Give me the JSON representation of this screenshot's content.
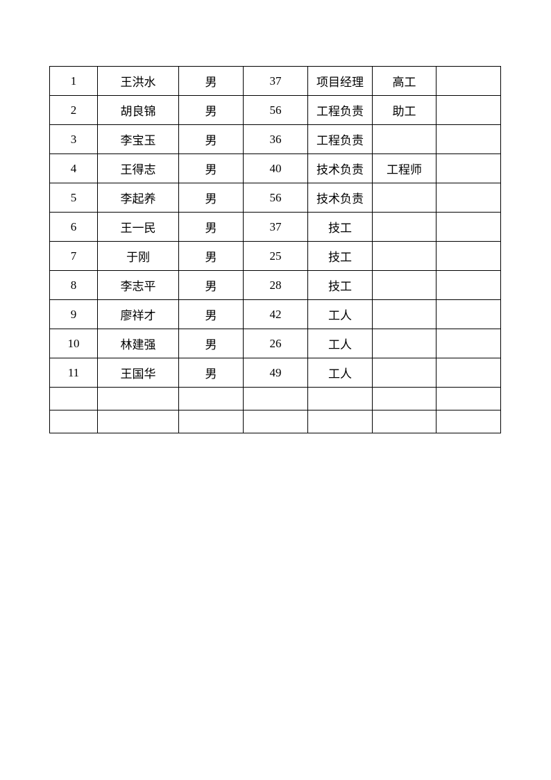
{
  "table": {
    "rows": [
      {
        "no": "1",
        "name": "王洪水",
        "gender": "男",
        "age": "37",
        "position": "项目经理",
        "title": "高工",
        "note": ""
      },
      {
        "no": "2",
        "name": "胡良锦",
        "gender": "男",
        "age": "56",
        "position": "工程负责",
        "title": "助工",
        "note": ""
      },
      {
        "no": "3",
        "name": "李宝玉",
        "gender": "男",
        "age": "36",
        "position": "工程负责",
        "title": "",
        "note": ""
      },
      {
        "no": "4",
        "name": "王得志",
        "gender": "男",
        "age": "40",
        "position": "技术负责",
        "title": "工程师",
        "note": ""
      },
      {
        "no": "5",
        "name": "李起养",
        "gender": "男",
        "age": "56",
        "position": "技术负责",
        "title": "",
        "note": ""
      },
      {
        "no": "6",
        "name": "王一民",
        "gender": "男",
        "age": "37",
        "position": "技工",
        "title": "",
        "note": ""
      },
      {
        "no": "7",
        "name": "于刚",
        "gender": "男",
        "age": "25",
        "position": "技工",
        "title": "",
        "note": ""
      },
      {
        "no": "8",
        "name": "李志平",
        "gender": "男",
        "age": "28",
        "position": "技工",
        "title": "",
        "note": ""
      },
      {
        "no": "9",
        "name": "廖祥才",
        "gender": "男",
        "age": "42",
        "position": "工人",
        "title": "",
        "note": ""
      },
      {
        "no": "10",
        "name": "林建强",
        "gender": "男",
        "age": "26",
        "position": "工人",
        "title": "",
        "note": ""
      },
      {
        "no": "11",
        "name": "王国华",
        "gender": "男",
        "age": "49",
        "position": "工人",
        "title": "",
        "note": ""
      }
    ],
    "empty_rows": 2
  }
}
